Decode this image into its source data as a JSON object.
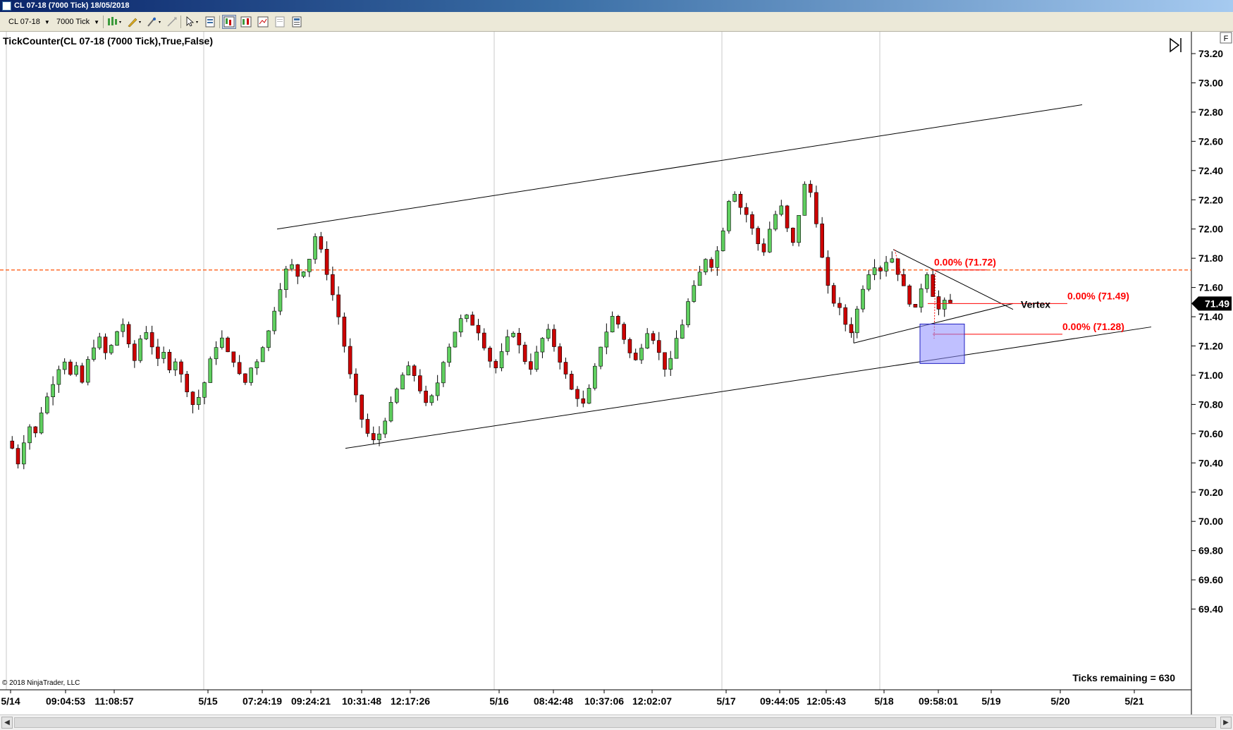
{
  "window": {
    "title": "CL 07-18 (7000 Tick)  18/05/2018"
  },
  "toolbar": {
    "instrument": "CL 07-18",
    "interval": "7000 Tick",
    "icons": [
      "bar-type-icon",
      "draw-pencil-icon",
      "crosshair-icon",
      "pointer-icon",
      "properties-icon",
      "data-box-icon",
      "chart-style-icon",
      "strategy-icon",
      "blank-page-icon",
      "template-icon"
    ]
  },
  "chart": {
    "indicator_label": "TickCounter(CL 07-18 (7000 Tick),True,False)",
    "ticks_remaining": "Ticks remaining = 630",
    "copyright": "© 2018 NinjaTrader, LLC",
    "last_price": "71.49",
    "price_flag": "F",
    "panel_icon": "play-to-end-icon",
    "colors": {
      "up": "#5fcf5f",
      "down": "#cc0000",
      "dashed_level": "#ff6d2d",
      "fib": "#ff0000",
      "box": "#8c8cff"
    }
  },
  "chart_data": {
    "type": "candlestick",
    "title": "",
    "ylim": [
      69.35,
      73.35
    ],
    "y_ticks": [
      "73.20",
      "73.00",
      "72.80",
      "72.60",
      "72.40",
      "72.20",
      "72.00",
      "71.80",
      "71.60",
      "71.40",
      "71.20",
      "71.00",
      "70.80",
      "70.60",
      "70.40",
      "70.20",
      "70.00",
      "69.80",
      "69.60",
      "69.40"
    ],
    "x_labels": [
      "5/14",
      "09:04:53",
      "11:08:57",
      "5/15",
      "07:24:19",
      "09:24:21",
      "10:31:48",
      "12:17:26",
      "5/16",
      "08:42:48",
      "10:37:06",
      "12:02:07",
      "5/17",
      "09:44:05",
      "12:05:43",
      "5/18",
      "09:58:01",
      "5/19",
      "5/20",
      "5/21"
    ],
    "horizontal_levels": [
      71.72
    ],
    "annotations": [
      {
        "text": "0.00% (71.72)",
        "price": 71.72
      },
      {
        "text": "0.00% (71.49)",
        "price": 71.49
      },
      {
        "text": "0.00% (71.28)",
        "price": 71.28
      },
      {
        "text": "Vertex",
        "price": 71.48
      }
    ],
    "box": {
      "price_top": 71.35,
      "price_bottom": 71.08
    },
    "path": [
      70.55,
      70.5,
      70.4,
      70.55,
      70.65,
      70.6,
      70.75,
      70.85,
      70.95,
      71.05,
      71.1,
      71.0,
      71.05,
      70.95,
      71.1,
      71.2,
      71.25,
      71.15,
      71.2,
      71.3,
      71.35,
      71.2,
      71.1,
      71.25,
      71.3,
      71.2,
      71.1,
      71.15,
      71.05,
      71.1,
      71.0,
      70.9,
      70.8,
      70.85,
      70.95,
      71.1,
      71.2,
      71.25,
      71.15,
      71.1,
      71.0,
      70.95,
      71.05,
      71.1,
      71.2,
      71.3,
      71.45,
      71.6,
      71.72,
      71.75,
      71.68,
      71.72,
      71.8,
      71.95,
      71.85,
      71.7,
      71.55,
      71.4,
      71.2,
      71.0,
      70.85,
      70.7,
      70.6,
      70.55,
      70.6,
      70.7,
      70.8,
      70.9,
      71.0,
      71.05,
      71.0,
      70.9,
      70.8,
      70.85,
      70.95,
      71.1,
      71.2,
      71.3,
      71.38,
      71.4,
      71.35,
      71.3,
      71.2,
      71.1,
      71.05,
      71.15,
      71.25,
      71.3,
      71.2,
      71.1,
      71.05,
      71.15,
      71.25,
      71.3,
      71.2,
      71.1,
      71.0,
      70.9,
      70.85,
      70.8,
      70.9,
      71.05,
      71.2,
      71.3,
      71.4,
      71.35,
      71.25,
      71.15,
      71.1,
      71.2,
      71.3,
      71.25,
      71.15,
      71.05,
      71.1,
      71.25,
      71.35,
      71.5,
      71.6,
      71.7,
      71.8,
      71.75,
      71.85,
      72.0,
      72.2,
      72.25,
      72.15,
      72.1,
      72.0,
      71.9,
      71.85,
      72.0,
      72.1,
      72.15,
      72.0,
      71.9,
      72.1,
      72.3,
      72.25,
      72.05,
      71.8,
      71.6,
      71.5,
      71.45,
      71.35,
      71.3,
      71.45,
      71.6,
      71.7,
      71.75,
      71.72,
      71.78,
      71.8,
      71.7,
      71.6,
      71.5,
      71.45,
      71.6,
      71.7,
      71.55,
      71.45,
      71.5,
      71.49
    ]
  }
}
